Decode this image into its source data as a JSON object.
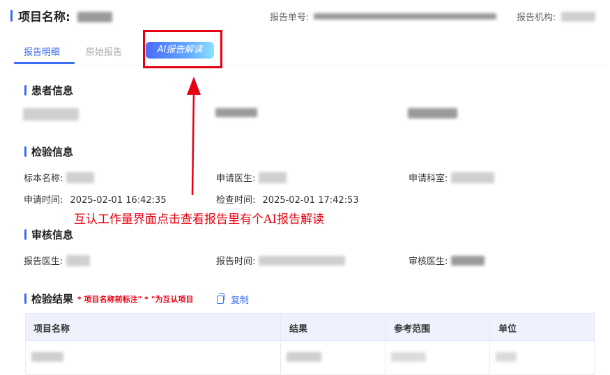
{
  "header": {
    "project_label": "项目名称:",
    "report_no_label": "报告单号:",
    "org_label": "报告机构:"
  },
  "tabs": {
    "detail": "报告明细",
    "original": "原始报告",
    "ai": "AI报告解读"
  },
  "patient": {
    "title": "患者信息"
  },
  "inspection": {
    "title": "检验信息",
    "specimen_label": "标本名称:",
    "doctor_label": "申请医生:",
    "dept_label": "申请科室:",
    "apply_time_label": "申请时间:",
    "apply_time": "2025-02-01 16:42:35",
    "check_time_label": "检查时间:",
    "check_time": "2025-02-01 17:42:53"
  },
  "annotation": "互认工作量界面点击查看报告里有个AI报告解读",
  "review": {
    "title": "审核信息",
    "report_doctor_label": "报告医生:",
    "report_time_label": "报告时间:",
    "review_doctor_label": "审核医生:"
  },
  "results": {
    "title": "检验结果",
    "note": "* 项目名称前标注\" * \"为互认项目",
    "copy": "复制",
    "columns": [
      "项目名称",
      "结果",
      "参考范围",
      "单位"
    ]
  },
  "colors": {
    "accent": "#3a6cf0",
    "annotation_red": "#e60012"
  },
  "icons": {
    "copy": "copy-icon",
    "arrow": "up-arrow-annotation"
  }
}
